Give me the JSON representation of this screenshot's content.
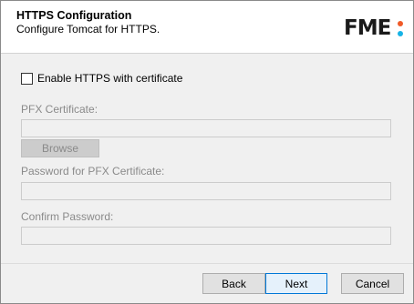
{
  "header": {
    "title": "HTTPS Configuration",
    "subtitle": "Configure Tomcat for HTTPS.",
    "logo_text": "FME",
    "logo_colors": {
      "top_dot": "#f05a28",
      "bottom_dot": "#17b3e6"
    }
  },
  "form": {
    "enable_https": {
      "label": "Enable HTTPS with certificate",
      "checked": false
    },
    "pfx_certificate": {
      "label": "PFX Certificate:",
      "value": ""
    },
    "browse_label": "Browse",
    "pfx_password": {
      "label": "Password for PFX Certificate:",
      "value": ""
    },
    "confirm_password": {
      "label": "Confirm Password:",
      "value": ""
    }
  },
  "footer": {
    "back_label": "Back",
    "next_label": "Next",
    "cancel_label": "Cancel"
  }
}
